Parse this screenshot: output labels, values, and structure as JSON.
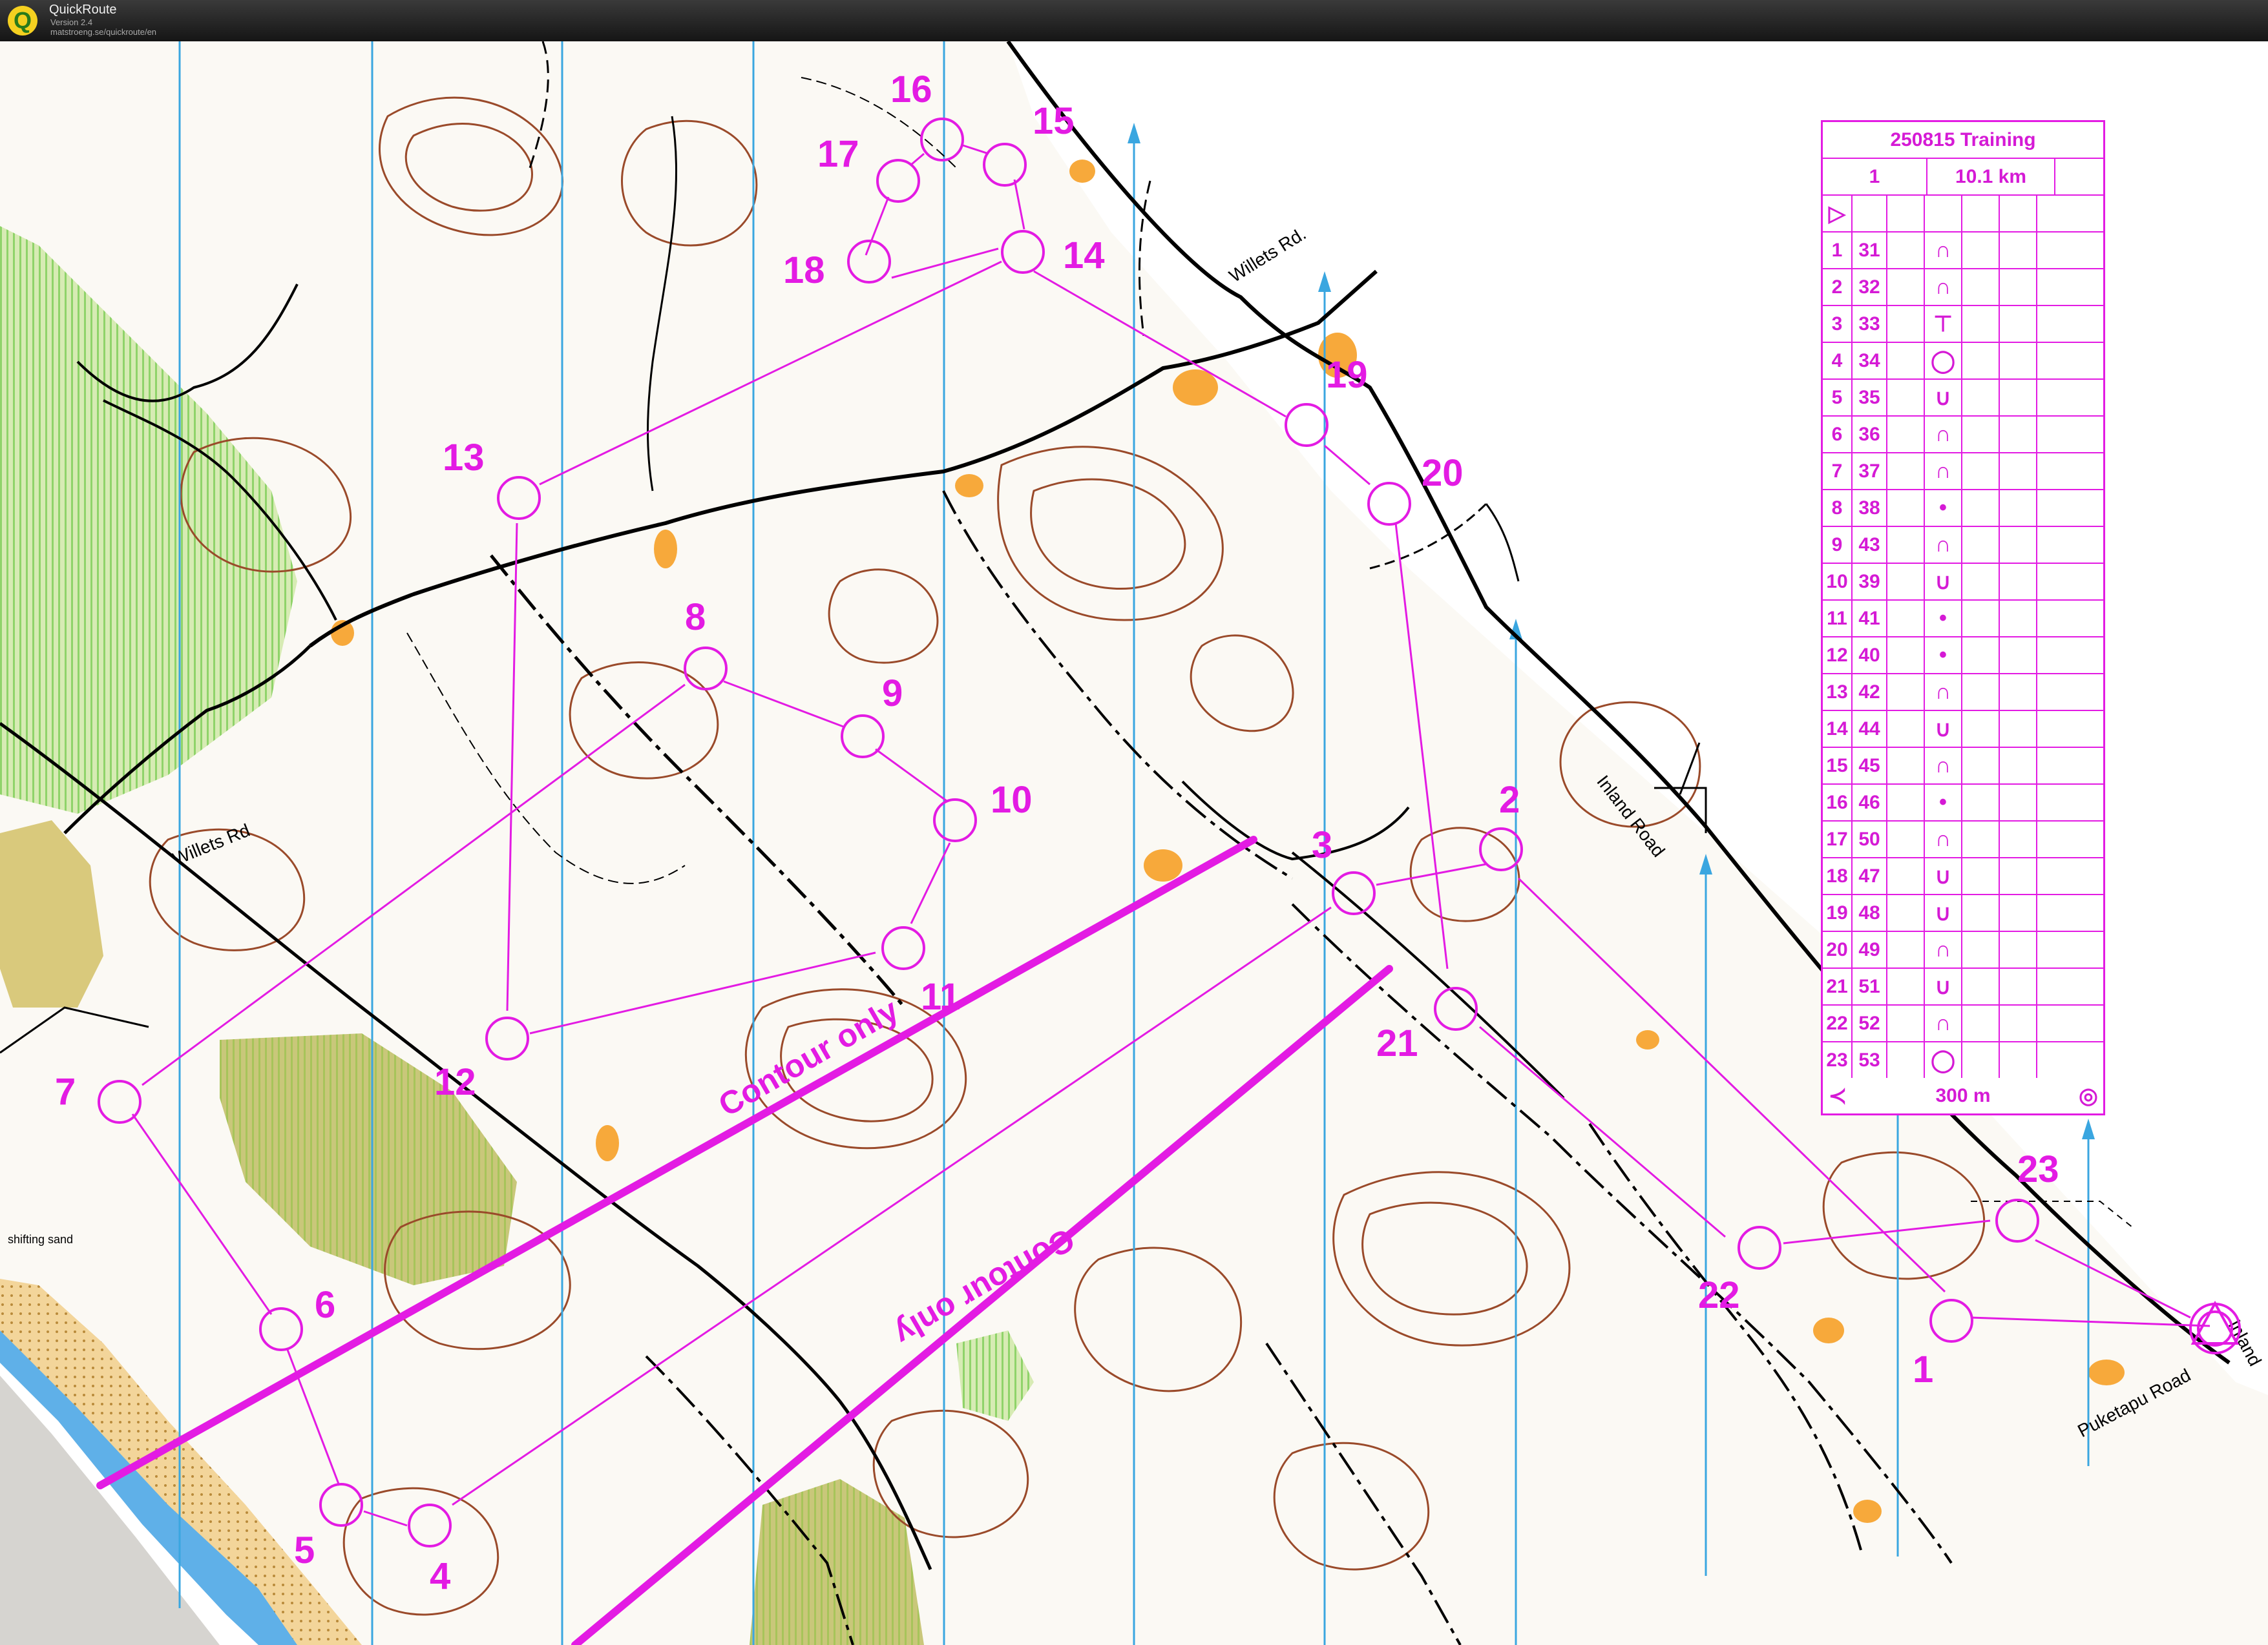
{
  "window": {
    "app_name": "QuickRoute",
    "version": "Version 2.4",
    "url": "matstroeng.se/quickroute/en"
  },
  "description_sheet": {
    "title": "250815 Training",
    "course": "1",
    "length": "10.1 km",
    "finish_distance": "300 m",
    "controls": [
      {
        "num": "1",
        "code": "31",
        "symbol": "knoll"
      },
      {
        "num": "2",
        "code": "32",
        "symbol": "knoll"
      },
      {
        "num": "3",
        "code": "33",
        "symbol": "spur"
      },
      {
        "num": "4",
        "code": "34",
        "symbol": "depression"
      },
      {
        "num": "5",
        "code": "35",
        "symbol": "reentrant"
      },
      {
        "num": "6",
        "code": "36",
        "symbol": "knoll"
      },
      {
        "num": "7",
        "code": "37",
        "symbol": "knoll"
      },
      {
        "num": "8",
        "code": "38",
        "symbol": "small-knoll"
      },
      {
        "num": "9",
        "code": "43",
        "symbol": "knoll"
      },
      {
        "num": "10",
        "code": "39",
        "symbol": "reentrant"
      },
      {
        "num": "11",
        "code": "41",
        "symbol": "small-knoll"
      },
      {
        "num": "12",
        "code": "40",
        "symbol": "small-knoll"
      },
      {
        "num": "13",
        "code": "42",
        "symbol": "knoll"
      },
      {
        "num": "14",
        "code": "44",
        "symbol": "reentrant"
      },
      {
        "num": "15",
        "code": "45",
        "symbol": "knoll"
      },
      {
        "num": "16",
        "code": "46",
        "symbol": "small-knoll"
      },
      {
        "num": "17",
        "code": "50",
        "symbol": "knoll"
      },
      {
        "num": "18",
        "code": "47",
        "symbol": "reentrant"
      },
      {
        "num": "19",
        "code": "48",
        "symbol": "reentrant"
      },
      {
        "num": "20",
        "code": "49",
        "symbol": "knoll"
      },
      {
        "num": "21",
        "code": "51",
        "symbol": "reentrant"
      },
      {
        "num": "22",
        "code": "52",
        "symbol": "knoll"
      },
      {
        "num": "23",
        "code": "53",
        "symbol": "depression"
      }
    ]
  },
  "map": {
    "course_color": "#e31be3",
    "contour_color": "#9a4a2a",
    "north_line_color": "#3aa6e0",
    "road_labels": [
      "Willets Rd.",
      "Willets Rd",
      "Inland Road",
      "Puketapu Road",
      "Inland"
    ],
    "area_labels": [
      "Contour only",
      "Contour only"
    ],
    "shifting_sand_label": "shifting sand",
    "control_labels": [
      "1",
      "2",
      "3",
      "4",
      "5",
      "6",
      "7",
      "8",
      "9",
      "10",
      "11",
      "12",
      "13",
      "14",
      "15",
      "16",
      "17",
      "18",
      "19",
      "20",
      "21",
      "22",
      "23"
    ]
  }
}
